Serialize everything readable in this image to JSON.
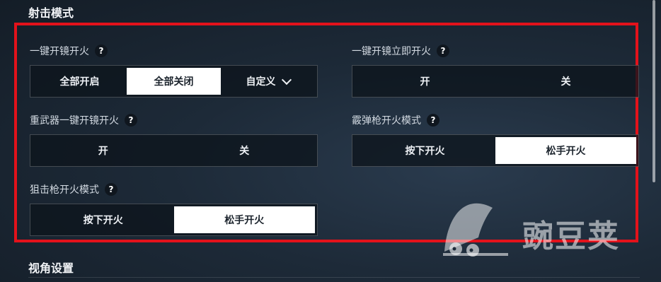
{
  "sections": {
    "shooting_mode": "射击模式",
    "view_settings": "视角设置"
  },
  "settings": {
    "scope_fire": {
      "label": "一键开镜开火",
      "help": "?",
      "options": [
        "全部开启",
        "全部关闭",
        "自定义"
      ],
      "selected": "全部关闭"
    },
    "scope_fire_instant": {
      "label": "一键开镜立即开火",
      "help": "?",
      "options": [
        "开",
        "关"
      ],
      "selected": ""
    },
    "heavy_weapon_scope_fire": {
      "label": "重武器一键开镜开火",
      "help": "?",
      "options": [
        "开",
        "关"
      ],
      "selected": ""
    },
    "shotgun_fire_mode": {
      "label": "霰弹枪开火模式",
      "help": "?",
      "options": [
        "按下开火",
        "松手开火"
      ],
      "selected": "松手开火"
    },
    "sniper_fire_mode": {
      "label": "狙击枪开火模式",
      "help": "?",
      "options": [
        "按下开火",
        "松手开火"
      ],
      "selected": "松手开火"
    }
  },
  "watermark": {
    "text": "豌豆荚"
  },
  "colors": {
    "highlight": "#e3121b",
    "selected_bg": "#ffffff"
  },
  "icons": {
    "dropdown": "chevron-down-icon",
    "help": "help-icon",
    "logo": "pea-pod-logo"
  }
}
